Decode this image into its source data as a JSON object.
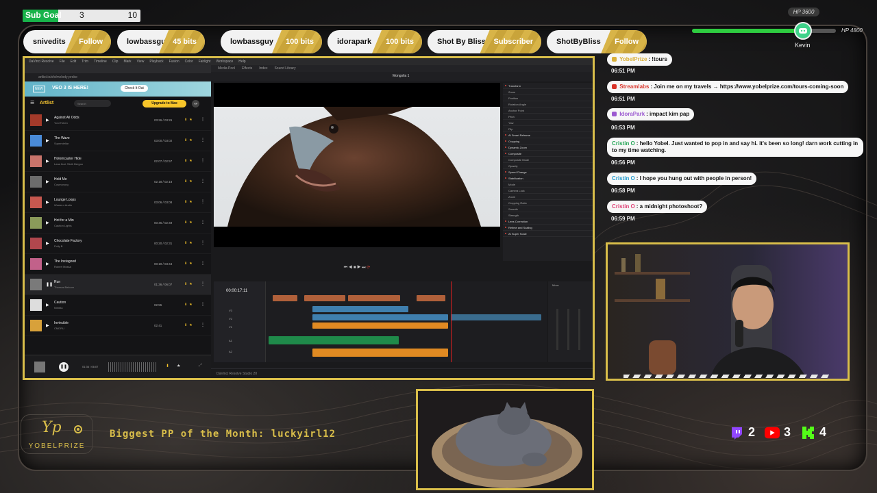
{
  "subgoal": {
    "label": "Sub Goal",
    "current": "3",
    "target": "10",
    "progress": 0.3
  },
  "events": [
    {
      "name": "snivedits",
      "action": "Follow"
    },
    {
      "name": "lowbassguy",
      "action": "45 bits"
    },
    {
      "name": "lowbassguy",
      "action": "100 bits"
    },
    {
      "name": "idorapark",
      "action": "100 bits"
    },
    {
      "name": "Shot By Bliss",
      "action": "Subscriber"
    },
    {
      "name": "ShotByBliss",
      "action": "Follow"
    }
  ],
  "hp": {
    "top_label": "HP 3600",
    "max_label": "HP 4800",
    "fraction": 0.75,
    "player_name": "Kevin"
  },
  "browser": {
    "window_menu": [
      "DaVinci Resolve",
      "File",
      "Edit",
      "Trim",
      "Timeline",
      "Clip",
      "Mark",
      "View",
      "Playback",
      "Fusion",
      "Color",
      "Fairlight",
      "Workspace",
      "Help"
    ],
    "url": "artlist.io/sfx/melody-probe",
    "banner": {
      "new": "NEW",
      "title": "VEO 3 IS HERE!",
      "button": "Check It Out"
    },
    "app_logo": "Artlist",
    "search_placeholder": "Search",
    "upgrade": "Upgrade to Max",
    "avatar": "YP",
    "tracks": [
      {
        "title": "Against All Odds",
        "artist": "Yoni Tkhen",
        "duration": "03:26 / 03:26",
        "art": "#a33a2a"
      },
      {
        "title": "The Wave",
        "artist": "Superstellar",
        "duration": "03:00 / 03:02",
        "art": "#4a8bd8"
      },
      {
        "title": "Holomcaster Hide",
        "artist": "Lana feat. Sloth Bergoo",
        "duration": "02:07 / 02:57",
        "art": "#c9746b"
      },
      {
        "title": "Hold Me",
        "artist": "Cosmonorg",
        "duration": "02:18 / 02:18",
        "art": "#6c6c6c"
      },
      {
        "title": "Lounge Loops",
        "artist": "Western Audio",
        "duration": "03:06 / 03:08",
        "art": "#c7584f"
      },
      {
        "title": "Hot for a Min",
        "artist": "Caution Lights",
        "duration": "00:46 / 02:49",
        "art": "#8a9a5a"
      },
      {
        "title": "Chocolate Factory",
        "artist": "Polly B",
        "duration": "00:20 / 02:31",
        "art": "#b0474d"
      },
      {
        "title": "The Instagood",
        "artist": "Robert Mossa",
        "duration": "00:19 / 03:44",
        "art": "#c2618a"
      },
      {
        "title": "Run",
        "artist": "Thomas Belcorn",
        "duration": "01:36 / 06:07",
        "art": "#7a7a7a",
        "active": true
      },
      {
        "title": "Caution",
        "artist": "Nimbla",
        "duration": "02:55",
        "art": "#ddd"
      },
      {
        "title": "Invincible",
        "artist": "CMDRU",
        "duration": "02:41",
        "art": "#d8a13a"
      }
    ],
    "player": {
      "time": "01:36 / 06:07"
    }
  },
  "resolve": {
    "project": "Mongolia 1",
    "timecode": "00:00:17:11",
    "status": "DaVinci Resolve Studio 20",
    "inspector": [
      "Transform",
      "Zoom",
      "Position",
      "Rotation Angle",
      "Anchor Point",
      "Pitch",
      "Yaw",
      "Flip",
      "AI Smart Reframe",
      "Cropping",
      "Dynamic Zoom",
      "Composite",
      "Composite Mode",
      "Opacity",
      "Speed Change",
      "Stabilization",
      "Mode",
      "Camera Lock",
      "Zoom",
      "Cropping Ratio",
      "Smooth",
      "Strength",
      "Lens Correction",
      "Retime and Scaling",
      "AI Super Scale"
    ],
    "tracks": [
      "V3",
      "V2",
      "V1",
      "A1",
      "A2"
    ]
  },
  "chat": [
    {
      "user": "YobelPrize",
      "user_color": "#d9b03a",
      "text": "!tours",
      "time": "06:51 PM"
    },
    {
      "user": "Streamlabs",
      "user_color": "#d9342a",
      "text": "Join me on my travels → https://www.yobelprize.com/tours-coming-soon",
      "time": "06:51 PM"
    },
    {
      "user": "IdoraPark",
      "user_color": "#9b59d0",
      "text": "impact kim pap",
      "time": "06:53 PM"
    },
    {
      "user": "Cristin O",
      "user_color": "#2aa75a",
      "text": "hello Yobel. Just wanted to pop in and say hi. it's been so long! darn work cutting in to my time watching.",
      "time": "06:56 PM"
    },
    {
      "user": "Cristin O",
      "user_color": "#2a9fd0",
      "text": "I hope you hung out with people in person!",
      "time": "06:58 PM"
    },
    {
      "user": "Cristin O",
      "user_color": "#e0477a",
      "text": "a midnight photoshoot?",
      "time": "06:59 PM"
    }
  ],
  "branding": {
    "logo": "Yp",
    "name": "YOBELPRIZE",
    "announcement": "Biggest PP of the Month: luckyirl12"
  },
  "socials": [
    {
      "icon": "twitch-icon",
      "count": "2",
      "color": "#9146ff"
    },
    {
      "icon": "youtube-icon",
      "count": "3",
      "color": "#ff0000"
    },
    {
      "icon": "kick-icon",
      "count": "4",
      "color": "#53fc18"
    }
  ]
}
